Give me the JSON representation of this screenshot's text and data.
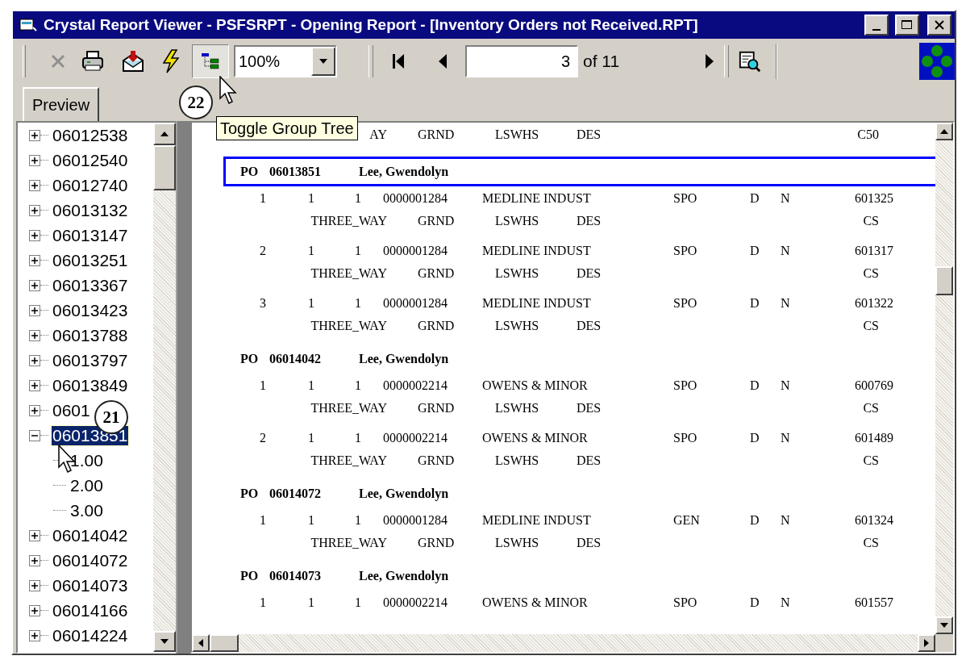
{
  "window": {
    "title": "Crystal Report Viewer - PSFSRPT - Opening Report - [Inventory Orders not Received.RPT]"
  },
  "toolbar": {
    "group_tree_pressed": true,
    "zoom": "100%",
    "page": "3",
    "page_total": "of 11"
  },
  "tooltip": "Toggle Group Tree",
  "callouts": [
    "22",
    "21"
  ],
  "tabs": [
    {
      "label": "Preview",
      "selected": true
    }
  ],
  "tree": [
    {
      "label": "06012538",
      "expanded": false,
      "selected": false
    },
    {
      "label": "06012540",
      "expanded": false,
      "selected": false
    },
    {
      "label": "06012740",
      "expanded": false,
      "selected": false
    },
    {
      "label": "06013132",
      "expanded": false,
      "selected": false
    },
    {
      "label": "06013147",
      "expanded": false,
      "selected": false
    },
    {
      "label": "06013251",
      "expanded": false,
      "selected": false
    },
    {
      "label": "06013367",
      "expanded": false,
      "selected": false
    },
    {
      "label": "06013423",
      "expanded": false,
      "selected": false
    },
    {
      "label": "06013788",
      "expanded": false,
      "selected": false
    },
    {
      "label": "06013797",
      "expanded": false,
      "selected": false
    },
    {
      "label": "06013849",
      "expanded": false,
      "selected": false
    },
    {
      "label": "0601",
      "expanded": false,
      "selected": false
    },
    {
      "label": "06013851",
      "expanded": true,
      "selected": true,
      "children": [
        {
          "label": "1.00",
          "selected": false
        },
        {
          "label": "2.00",
          "selected": false
        },
        {
          "label": "3.00",
          "selected": false
        }
      ]
    },
    {
      "label": "06014042",
      "expanded": false,
      "selected": false
    },
    {
      "label": "06014072",
      "expanded": false,
      "selected": false
    },
    {
      "label": "06014073",
      "expanded": false,
      "selected": false
    },
    {
      "label": "06014166",
      "expanded": false,
      "selected": false
    },
    {
      "label": "06014224",
      "expanded": false,
      "selected": false
    }
  ],
  "report": {
    "top_row": [
      "AY",
      "GRND",
      "LSWHS",
      "DES",
      "C50"
    ],
    "groups": [
      {
        "po_label": "PO",
        "po": "06013851",
        "buyer": "Lee, Gwendolyn",
        "selected": true,
        "lines": [
          {
            "main": [
              "1",
              "1",
              "1",
              "0000001284",
              "MEDLINE INDUST",
              "SPO",
              "D",
              "N",
              "601325"
            ],
            "sub": [
              "THREE_WAY",
              "GRND",
              "LSWHS",
              "DES",
              "CS"
            ]
          },
          {
            "main": [
              "2",
              "1",
              "1",
              "0000001284",
              "MEDLINE INDUST",
              "SPO",
              "D",
              "N",
              "601317"
            ],
            "sub": [
              "THREE_WAY",
              "GRND",
              "LSWHS",
              "DES",
              "CS"
            ]
          },
          {
            "main": [
              "3",
              "1",
              "1",
              "0000001284",
              "MEDLINE INDUST",
              "SPO",
              "D",
              "N",
              "601322"
            ],
            "sub": [
              "THREE_WAY",
              "GRND",
              "LSWHS",
              "DES",
              "CS"
            ]
          }
        ]
      },
      {
        "po_label": "PO",
        "po": "06014042",
        "buyer": "Lee, Gwendolyn",
        "selected": false,
        "lines": [
          {
            "main": [
              "1",
              "1",
              "1",
              "0000002214",
              "OWENS & MINOR",
              "SPO",
              "D",
              "N",
              "600769"
            ],
            "sub": [
              "THREE_WAY",
              "GRND",
              "LSWHS",
              "DES",
              "CS"
            ]
          },
          {
            "main": [
              "2",
              "1",
              "1",
              "0000002214",
              "OWENS & MINOR",
              "SPO",
              "D",
              "N",
              "601489"
            ],
            "sub": [
              "THREE_WAY",
              "GRND",
              "LSWHS",
              "DES",
              "CS"
            ]
          }
        ]
      },
      {
        "po_label": "PO",
        "po": "06014072",
        "buyer": "Lee, Gwendolyn",
        "selected": false,
        "lines": [
          {
            "main": [
              "1",
              "1",
              "1",
              "0000001284",
              "MEDLINE INDUST",
              "GEN",
              "D",
              "N",
              "601324"
            ],
            "sub": [
              "THREE_WAY",
              "GRND",
              "LSWHS",
              "DES",
              "CS"
            ]
          }
        ]
      },
      {
        "po_label": "PO",
        "po": "06014073",
        "buyer": "Lee, Gwendolyn",
        "selected": false,
        "lines": [
          {
            "main": [
              "1",
              "1",
              "1",
              "0000002214",
              "OWENS & MINOR",
              "SPO",
              "D",
              "N",
              "601557"
            ]
          }
        ]
      }
    ]
  }
}
